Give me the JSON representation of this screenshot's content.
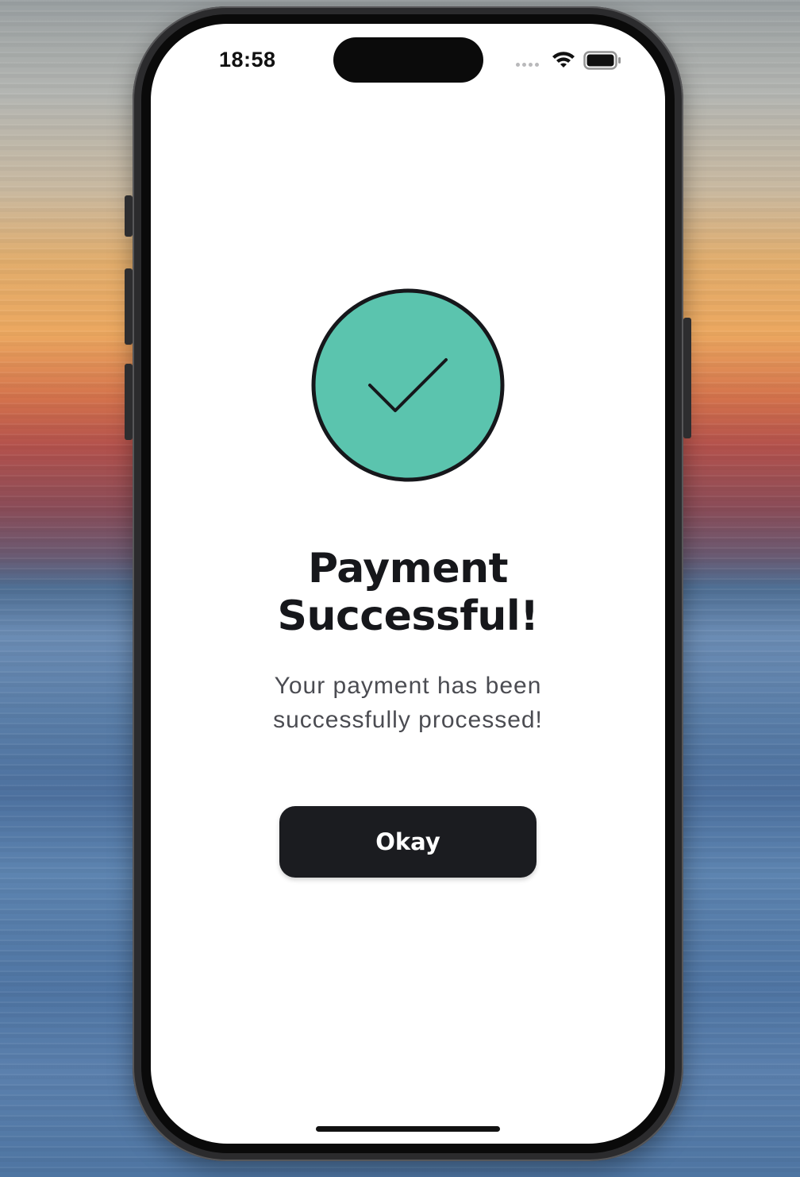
{
  "status_bar": {
    "time": "18:58",
    "icons": [
      "cellular-signal-icon",
      "wifi-icon",
      "battery-icon"
    ]
  },
  "success_icon": {
    "name": "checkmark-icon",
    "fill_color": "#5bc4ae",
    "stroke_color": "#16171b"
  },
  "main": {
    "title_lines": [
      "Payment",
      "Successful!"
    ],
    "message_lines": [
      "Your payment has been",
      "successfully processed!"
    ]
  },
  "actions": {
    "okay_label": "Okay"
  },
  "colors": {
    "button_background": "#1b1c20",
    "title_text": "#16171b",
    "message_text": "#4b4c52"
  }
}
